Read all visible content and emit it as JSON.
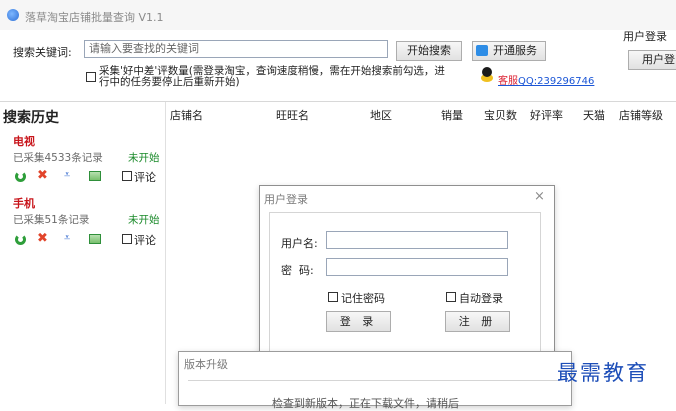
{
  "window": {
    "title": "落草淘宝店铺批量查询 V1.1"
  },
  "search": {
    "label": "搜索关键词:",
    "placeholder": "请输入要查找的关键词",
    "search_button": "开始搜索",
    "service_button": "开通服务"
  },
  "collect_option": {
    "line1": "采集'好中差'评数量(需登录淘宝，查询速度稍慢，需在开始搜索前勾选，进",
    "line2": "行中的任务要停止后重新开始)"
  },
  "support": {
    "prefix": "客服",
    "qq": "QQ:239296746"
  },
  "top_login": {
    "label": "用户登录",
    "button": "用户登"
  },
  "history": {
    "title": "搜索历史",
    "items": [
      {
        "name": "电视",
        "record": "已采集4533条记录",
        "status": "未开始",
        "comment": "评论"
      },
      {
        "name": "手机",
        "record": "已采集51条记录",
        "status": "未开始",
        "comment": "评论"
      }
    ]
  },
  "table": {
    "columns": [
      "店铺名",
      "旺旺名",
      "地区",
      "销量",
      "宝贝数",
      "好评率",
      "天猫",
      "店铺等级"
    ]
  },
  "login_dialog": {
    "title": "用户登录",
    "close": "×",
    "username_label": "用户名:",
    "password_label": "密  码:",
    "remember": "记住密码",
    "auto_login": "自动登录",
    "login_button": "登 录",
    "register_button": "注 册"
  },
  "update_dialog": {
    "title": "版本升级",
    "message": "检查到新版本，正在下载文件，请稍后"
  },
  "watermark": "最需教育"
}
